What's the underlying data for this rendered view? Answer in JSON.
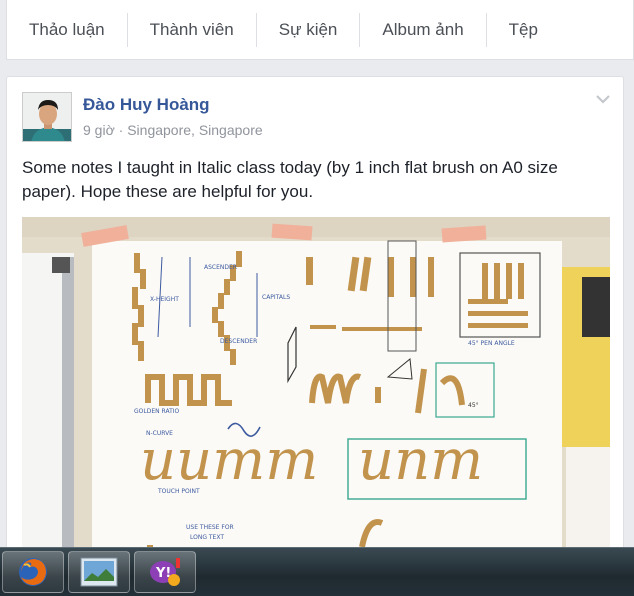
{
  "tabs": [
    "Thảo luận",
    "Thành viên",
    "Sự kiện",
    "Album ảnh",
    "Tệp"
  ],
  "post": {
    "author": "Đào Huy Hoàng",
    "time": "9 giờ",
    "separator": "·",
    "location": "Singapore, Singapore",
    "text": "Some notes I taught in Italic class today (by 1 inch flat brush on A0 size paper). Hope these are helpful for you."
  },
  "photo_labels": {
    "ascender": "ASCENDER",
    "x_height": "X-HEIGHT",
    "descender": "DESCENDER",
    "capitals": "CAPITALS",
    "pen_angle": "45° PEN ANGLE",
    "golden_ratio": "GOLDEN RATIO",
    "n_curve": "N-CURVE",
    "touch_point": "TOUCH POINT",
    "use_these": "USE THESE FOR",
    "long_text": "LONG TEXT",
    "deg45": "45°",
    "word_a": "uumm",
    "word_b": "unm"
  },
  "taskbar": {
    "apps": [
      "firefox-icon",
      "picture-viewer-icon",
      "messenger-icon"
    ]
  },
  "colors": {
    "link": "#365899",
    "meta": "#90949c",
    "ink": "#b8893e"
  }
}
